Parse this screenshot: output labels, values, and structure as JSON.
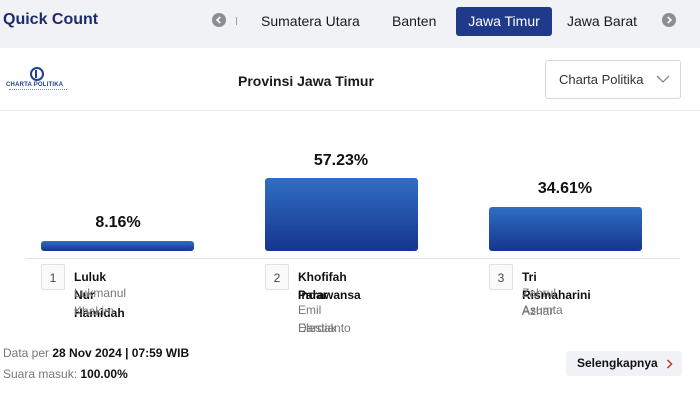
{
  "header": {
    "title": "Quick Count",
    "tabs": [
      {
        "label": "Sumatera Utara",
        "active": false
      },
      {
        "label": "Banten",
        "active": false
      },
      {
        "label": "Jawa Timur",
        "active": true
      },
      {
        "label": "Jawa Barat",
        "active": false
      }
    ]
  },
  "card": {
    "logo_text": "CHARTA POLITIKA",
    "province_title": "Provinsi Jawa Timur",
    "source_select": {
      "value": "Charta Politika"
    }
  },
  "candidates": [
    {
      "number": "1",
      "name": "Luluk Nur Hamidah",
      "deputy": "Lukmanul Khakim",
      "percent": "8.16%",
      "value": 8.16
    },
    {
      "number": "2",
      "name_line1": "Khofifah Indar",
      "name_line2": "Parawansa",
      "deputy_line1": "Emil Elestianto",
      "deputy_line2": "Dardak",
      "percent": "57.23%",
      "value": 57.23
    },
    {
      "number": "3",
      "name": "Tri Rismaharini",
      "deputy_line1": "Zahrul Azhar",
      "deputy_line2": "Asumta",
      "percent": "34.61%",
      "value": 34.61
    }
  ],
  "footer": {
    "data_per_label": "Data per",
    "data_per_value": "28 Nov 2024 | 07:59 WIB",
    "votes_label": "Suara masuk:",
    "votes_value": "100.00%",
    "more_label": "Selengkapnya"
  },
  "colors": {
    "accent": "#1f3a8a",
    "bar_top": "#2f6fc2",
    "bar_bottom": "#16358e"
  }
}
